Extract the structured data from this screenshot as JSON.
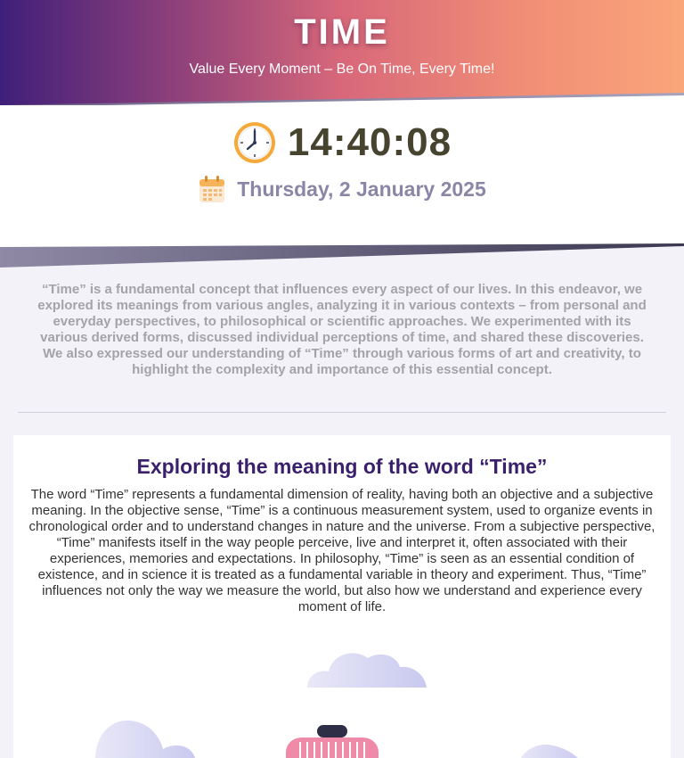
{
  "header": {
    "title": "TIME",
    "subtitle": "Value Every Moment – Be On Time, Every Time!"
  },
  "clock": {
    "time": "14:40:08",
    "date": "Thursday, 2 January 2025",
    "time_icon": "clock-icon",
    "date_icon": "calendar-icon"
  },
  "intro": {
    "text": "“Time” is a fundamental concept that influences every aspect of our lives. In this endeavor, we explored its meanings from various angles, analyzing it in various contexts – from personal and everyday perspectives, to philosophical or scientific approaches. We experimented with its various derived forms, discussed individual perceptions of time, and shared these discoveries. We also expressed our understanding of “Time” through various forms of art and creativity, to highlight the complexity and importance of this essential concept."
  },
  "section": {
    "title": "Exploring the meaning of the word “Time”",
    "body": "The word “Time” represents a fundamental dimension of reality, having both an objective and a subjective meaning. In the objective sense, “Time” is a continuous measurement system, used to organize events in chronological order and to understand changes in nature and the universe. From a subjective perspective, “Time” manifests itself in the way people perceive, live and interpret it, often associated with their experiences, memories and expectations. In philosophy, “Time” is seen as an essential condition of existence, and in science it is treated as a fundamental variable in theory and experiment. Thus, “Time” influences not only the way we measure the world, but also how we understand and experience every moment of life."
  },
  "colors": {
    "gradient_start": "#3f1f7a",
    "gradient_mid": "#d8687a",
    "gradient_end": "#fba57a",
    "time_text": "#46432f",
    "date_text": "#8b86a6",
    "section_title": "#3a1f6b"
  }
}
